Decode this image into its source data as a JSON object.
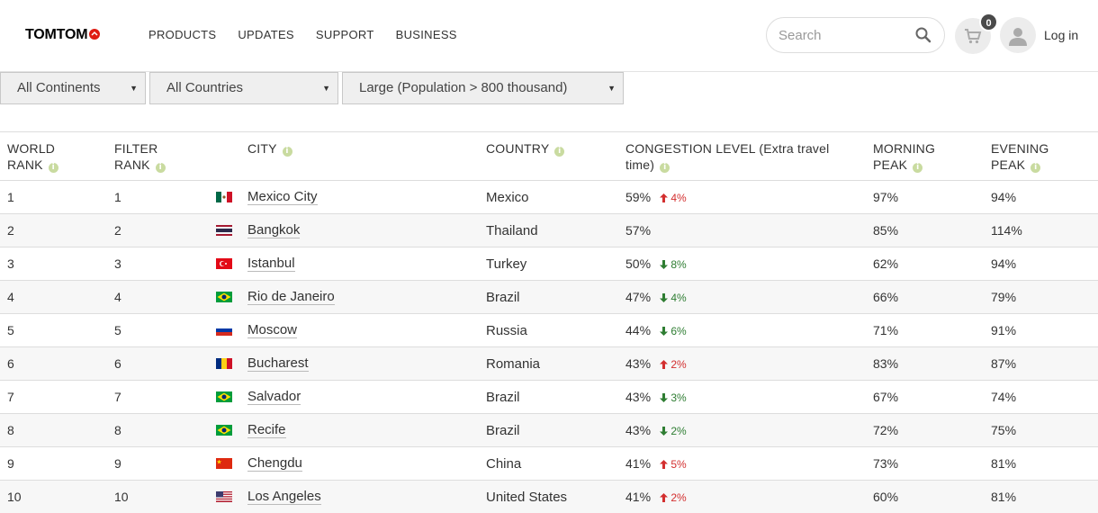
{
  "header": {
    "logo": "TOMTOM",
    "nav": [
      "PRODUCTS",
      "UPDATES",
      "SUPPORT",
      "BUSINESS"
    ],
    "search_placeholder": "Search",
    "cart_count": "0",
    "login_label": "Log in"
  },
  "filters": {
    "continent": "All Continents",
    "country": "All Countries",
    "size": "Large (Population > 800 thousand)"
  },
  "table": {
    "headers": {
      "world_rank": [
        "WORLD",
        "RANK"
      ],
      "filter_rank": [
        "FILTER",
        "RANK"
      ],
      "city": "CITY",
      "country": "COUNTRY",
      "congestion": [
        "CONGESTION LEVEL (Extra travel",
        "time)"
      ],
      "morning_peak": [
        "MORNING",
        "PEAK"
      ],
      "evening_peak": [
        "EVENING",
        "PEAK"
      ]
    },
    "rows": [
      {
        "world_rank": "1",
        "filter_rank": "1",
        "flag": "mx",
        "city": "Mexico City",
        "country": "Mexico",
        "congestion": "59%",
        "change": "4%",
        "dir": "up",
        "morning": "97%",
        "evening": "94%"
      },
      {
        "world_rank": "2",
        "filter_rank": "2",
        "flag": "th",
        "city": "Bangkok",
        "country": "Thailand",
        "congestion": "57%",
        "change": "",
        "dir": "",
        "morning": "85%",
        "evening": "114%"
      },
      {
        "world_rank": "3",
        "filter_rank": "3",
        "flag": "tr",
        "city": "Istanbul",
        "country": "Turkey",
        "congestion": "50%",
        "change": "8%",
        "dir": "down",
        "morning": "62%",
        "evening": "94%"
      },
      {
        "world_rank": "4",
        "filter_rank": "4",
        "flag": "br",
        "city": "Rio de Janeiro",
        "country": "Brazil",
        "congestion": "47%",
        "change": "4%",
        "dir": "down",
        "morning": "66%",
        "evening": "79%"
      },
      {
        "world_rank": "5",
        "filter_rank": "5",
        "flag": "ru",
        "city": "Moscow",
        "country": "Russia",
        "congestion": "44%",
        "change": "6%",
        "dir": "down",
        "morning": "71%",
        "evening": "91%"
      },
      {
        "world_rank": "6",
        "filter_rank": "6",
        "flag": "ro",
        "city": "Bucharest",
        "country": "Romania",
        "congestion": "43%",
        "change": "2%",
        "dir": "up",
        "morning": "83%",
        "evening": "87%"
      },
      {
        "world_rank": "7",
        "filter_rank": "7",
        "flag": "br",
        "city": "Salvador",
        "country": "Brazil",
        "congestion": "43%",
        "change": "3%",
        "dir": "down",
        "morning": "67%",
        "evening": "74%"
      },
      {
        "world_rank": "8",
        "filter_rank": "8",
        "flag": "br",
        "city": "Recife",
        "country": "Brazil",
        "congestion": "43%",
        "change": "2%",
        "dir": "down",
        "morning": "72%",
        "evening": "75%"
      },
      {
        "world_rank": "9",
        "filter_rank": "9",
        "flag": "cn",
        "city": "Chengdu",
        "country": "China",
        "congestion": "41%",
        "change": "5%",
        "dir": "up",
        "morning": "73%",
        "evening": "81%"
      },
      {
        "world_rank": "10",
        "filter_rank": "10",
        "flag": "us",
        "city": "Los Angeles",
        "country": "United States",
        "congestion": "41%",
        "change": "2%",
        "dir": "up",
        "morning": "60%",
        "evening": "81%"
      }
    ]
  },
  "colors": {
    "increase": "#d32f2f",
    "decrease": "#2e7d32",
    "info_icon": "#c9dba0",
    "brand_red": "#df1b12"
  }
}
